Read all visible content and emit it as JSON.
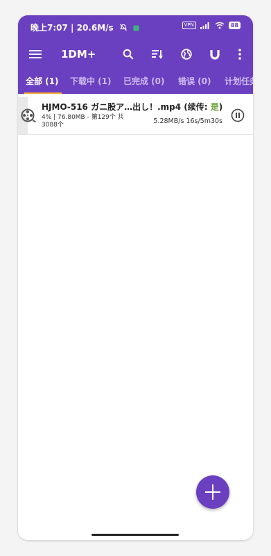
{
  "colors": {
    "accent": "#6a3fc0",
    "tab_indicator": "#f7a93c",
    "resume_yes": "#6fa140"
  },
  "status_bar": {
    "time": "晚上7:07",
    "network_speed": "| 20.6M/s",
    "vpn_label": "VPN",
    "battery": "88"
  },
  "toolbar": {
    "menu_icon": "hamburger-menu-icon",
    "title": "1DM+",
    "search_icon": "search-icon",
    "sort_icon": "sort-icon",
    "browser_icon": "globe-icon",
    "magnet_icon": "magnet-icon",
    "more_icon": "more-vert-icon"
  },
  "tabs": [
    {
      "label": "全部 (1)",
      "active": true
    },
    {
      "label": "下载中 (1)"
    },
    {
      "label": "已完成 (0)"
    },
    {
      "label": "错误 (0)"
    },
    {
      "label": "计划任务"
    }
  ],
  "downloads": [
    {
      "name": "HJMO-516 ガニ股ア…出し！.mp4 (续传: ",
      "resume": "是",
      "name_end": ")",
      "meta": "4% | 76.80MB - 第129个 共 3088个",
      "speed": "5.28MB/s 16s/5m30s",
      "progress": 0.04,
      "icon": "film-reel-icon",
      "action_icon": "pause-icon"
    }
  ],
  "fab": {
    "icon": "add-icon"
  }
}
